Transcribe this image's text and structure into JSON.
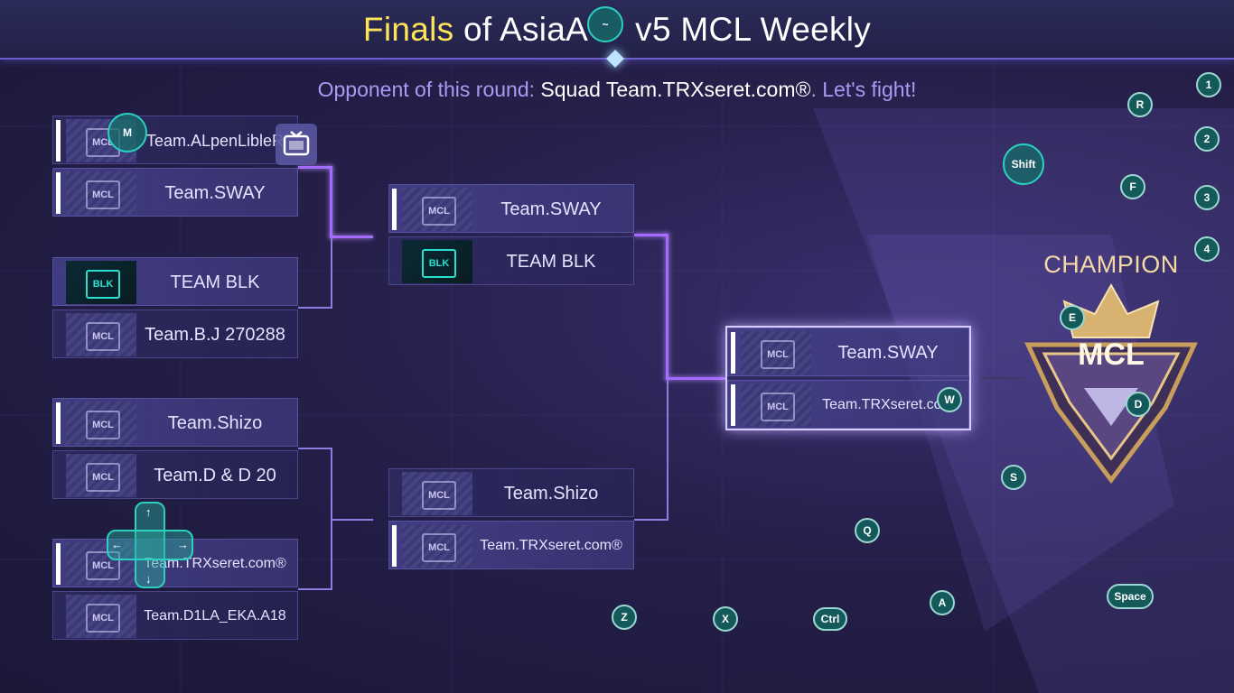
{
  "header": {
    "title_highlight": "Finals",
    "title_rest": " of AsiaA",
    "title_tail": "v5 MCL Weekly",
    "subtitle_prefix": "Opponent of this round: ",
    "subtitle_opponent": "Squad Team.TRXseret.com®",
    "subtitle_suffix": ". Let's fight!"
  },
  "bracket": {
    "round1": [
      {
        "name": "Team.ALpenLibleR",
        "logo": "mcl-logo"
      },
      {
        "name": "Team.SWAY",
        "logo": "mcl-logo"
      },
      {
        "name": "TEAM BLK",
        "logo": "blk-logo"
      },
      {
        "name": "Team.B.J 270288",
        "logo": "mcl-logo"
      },
      {
        "name": "Team.Shizo",
        "logo": "mcl-logo"
      },
      {
        "name": "Team.D & D 20",
        "logo": "mcl-logo"
      },
      {
        "name": "Team.TRXseret.com®",
        "logo": "mcl-logo"
      },
      {
        "name": "Team.D1LA_EKA.A18",
        "logo": "mcl-logo"
      }
    ],
    "round2": [
      {
        "name": "Team.SWAY",
        "logo": "mcl-logo"
      },
      {
        "name": "TEAM BLK",
        "logo": "blk-logo"
      },
      {
        "name": "Team.Shizo",
        "logo": "mcl-logo"
      },
      {
        "name": "Team.TRXseret.com®",
        "logo": "mcl-logo"
      }
    ],
    "final": [
      {
        "name": "Team.SWAY",
        "logo": "mcl-logo"
      },
      {
        "name": "Team.TRXseret.com",
        "logo": "mcl-logo"
      }
    ],
    "logo_text": "MCL",
    "blk_logo_text": "BLK"
  },
  "champion": {
    "label": "CHAMPION",
    "trophy_text": "MCL"
  },
  "overlay_keys": {
    "one": "1",
    "two": "2",
    "three": "3",
    "four": "4",
    "r": "R",
    "f": "F",
    "e": "E",
    "d": "D",
    "w": "W",
    "s": "S",
    "q": "Q",
    "a": "A",
    "z": "Z",
    "x": "X",
    "ctrl": "Ctrl",
    "space": "Space",
    "shift": "Shift",
    "m": "M",
    "tilde": "~",
    "up": "↑",
    "down": "↓",
    "left": "←",
    "right": "→"
  },
  "colors": {
    "accent_purple": "#a36bff",
    "title_highlight": "#ffe45a",
    "subtitle": "#a99bf2",
    "key_teal": "#155a5a"
  }
}
